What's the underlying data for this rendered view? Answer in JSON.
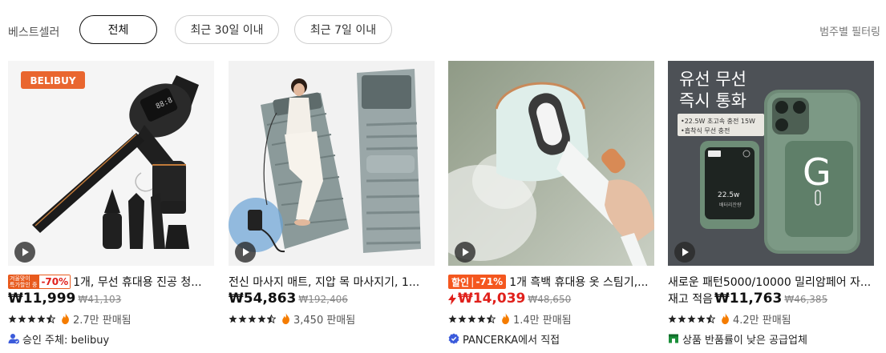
{
  "filters": {
    "title": "베스트셀러",
    "chips": [
      "전체",
      "최근 30일 이내",
      "최근 7일 이내"
    ],
    "active": "전체",
    "category_filter_link": "범주별 필터링"
  },
  "colors": {
    "accent_red": "#e0201b",
    "badge_orange": "#f4571f",
    "fire_orange": "#f57c00",
    "verified_blue": "#3b5bdb",
    "store_green": "#1b8f3a"
  },
  "products": [
    {
      "title": "1개, 무선 휴대용 진공 청...",
      "badge": {
        "type": "winter",
        "line1": "겨울맞이",
        "line2": "특가할인 중",
        "discount": "-70%"
      },
      "price": "₩11,999",
      "original_price": "₩41,103",
      "rating": 4.5,
      "sold": "2.7만 판매됨",
      "seller": "승인 주체: belibuy",
      "seller_icon": "verified-user-icon",
      "image": {
        "brand_label": "BELIBUY",
        "icon": "handheld-vacuum-image"
      }
    },
    {
      "title": "전신 마사지 매트, 지압 목 마사지기, 1...",
      "price": "₩54,863",
      "original_price": "₩192,406",
      "rating": 4.5,
      "sold": "3,450 판매됨",
      "image": {
        "icon": "massage-mat-image"
      }
    },
    {
      "title": "1개 흑백 휴대용 옷 스팀기,...",
      "badge": {
        "type": "sale",
        "label": "할인",
        "discount": "-71%"
      },
      "price": "₩14,039",
      "price_red": true,
      "original_price": "₩48,650",
      "rating": 4.5,
      "sold": "1.4만 판매됨",
      "seller": "PANCERKA에서 직접",
      "seller_icon": "verified-badge-icon",
      "image": {
        "icon": "garment-steamer-image"
      }
    },
    {
      "title": "새로운 패턴5000/10000 밀리암페어 자...",
      "prefix": "재고 적음",
      "price": "₩11,763",
      "original_price": "₩46,385",
      "rating": 4.5,
      "sold": "4.2만 판매됨",
      "seller": "상품 반품률이 낮은 공급업체",
      "seller_icon": "store-icon",
      "image": {
        "headline_1": "유선 무선",
        "headline_2": "즉시 통화",
        "spec_1": "•22.5W 초고속 충전 15W",
        "spec_2": "•흡착식 무선 충전",
        "screen_text": "22.5w",
        "screen_sub": "배터리잔량",
        "logo_letter": "G",
        "icon": "power-bank-image"
      }
    }
  ]
}
